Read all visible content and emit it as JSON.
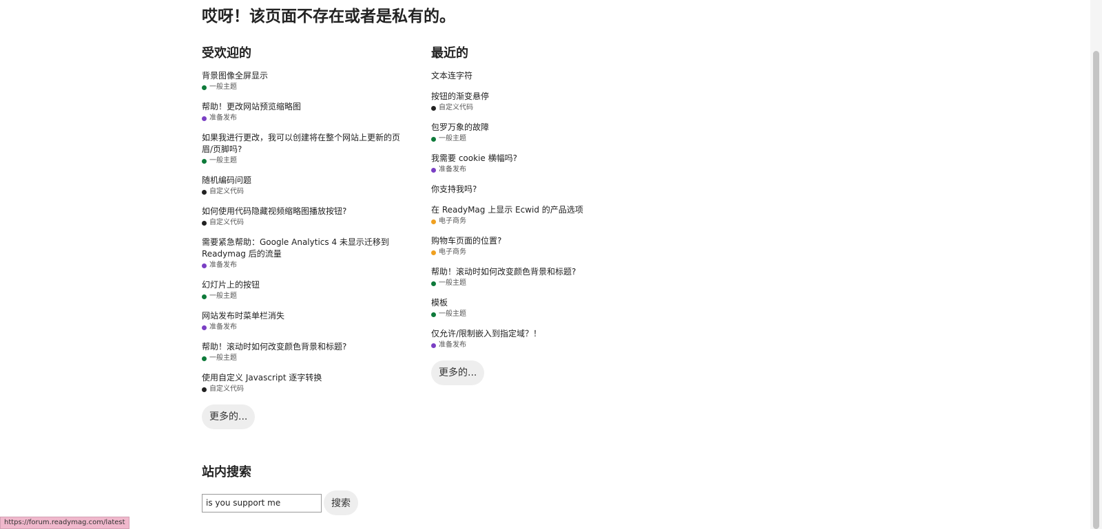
{
  "page_title": "哎呀！该页面不存在或者是私有的。",
  "popular": {
    "heading": "受欢迎的",
    "topics": [
      {
        "title": "背景图像全屏显示",
        "category": "一般主题",
        "cat_color": "#0e7a3a"
      },
      {
        "title": "帮助！更改网站预览缩略图",
        "category": "准备发布",
        "cat_color": "#7a3fc4"
      },
      {
        "title": "如果我进行更改，我可以创建将在整个网站上更新的页眉/页脚吗?",
        "category": "一般主题",
        "cat_color": "#0e7a3a"
      },
      {
        "title": "随机编码问题",
        "category": "自定义代码",
        "cat_color": "#222222"
      },
      {
        "title": "如何使用代码隐藏视频缩略图播放按钮?",
        "category": "自定义代码",
        "cat_color": "#222222"
      },
      {
        "title": "需要紧急帮助：Google Analytics 4 未显示迁移到 Readymag 后的流量",
        "category": "准备发布",
        "cat_color": "#7a3fc4"
      },
      {
        "title": "幻灯片上的按钮",
        "category": "一般主题",
        "cat_color": "#0e7a3a"
      },
      {
        "title": "网站发布时菜单栏消失",
        "category": "准备发布",
        "cat_color": "#7a3fc4"
      },
      {
        "title": "帮助！滚动时如何改变颜色背景和标题?",
        "category": "一般主题",
        "cat_color": "#0e7a3a"
      },
      {
        "title": "使用自定义 Javascript 逐字转换",
        "category": "自定义代码",
        "cat_color": "#222222"
      }
    ],
    "more_label": "更多的..."
  },
  "recent": {
    "heading": "最近的",
    "topics": [
      {
        "title": "文本连字符",
        "category": "",
        "cat_color": ""
      },
      {
        "title": "按钮的渐变悬停",
        "category": "自定义代码",
        "cat_color": "#222222"
      },
      {
        "title": "包罗万象的故障",
        "category": "一般主题",
        "cat_color": "#0e7a3a"
      },
      {
        "title": "我需要 cookie 横幅吗?",
        "category": "准备发布",
        "cat_color": "#7a3fc4"
      },
      {
        "title": "你支持我吗?",
        "category": "",
        "cat_color": ""
      },
      {
        "title": "在 ReadyMag 上显示 Ecwid 的产品选项",
        "category": "电子商务",
        "cat_color": "#f0a020"
      },
      {
        "title": "购物车页面的位置?",
        "category": "电子商务",
        "cat_color": "#f0a020"
      },
      {
        "title": "帮助！滚动时如何改变颜色背景和标题?",
        "category": "一般主题",
        "cat_color": "#0e7a3a"
      },
      {
        "title": "模板",
        "category": "一般主题",
        "cat_color": "#0e7a3a"
      },
      {
        "title": "仅允许/限制嵌入到指定域？！",
        "category": "准备发布",
        "cat_color": "#7a3fc4"
      }
    ],
    "more_label": "更多的..."
  },
  "search": {
    "heading": "站内搜索",
    "input_value": "is you support me",
    "button_label": "搜索"
  },
  "status_bar": {
    "url": "https://forum.readymag.com/latest"
  }
}
